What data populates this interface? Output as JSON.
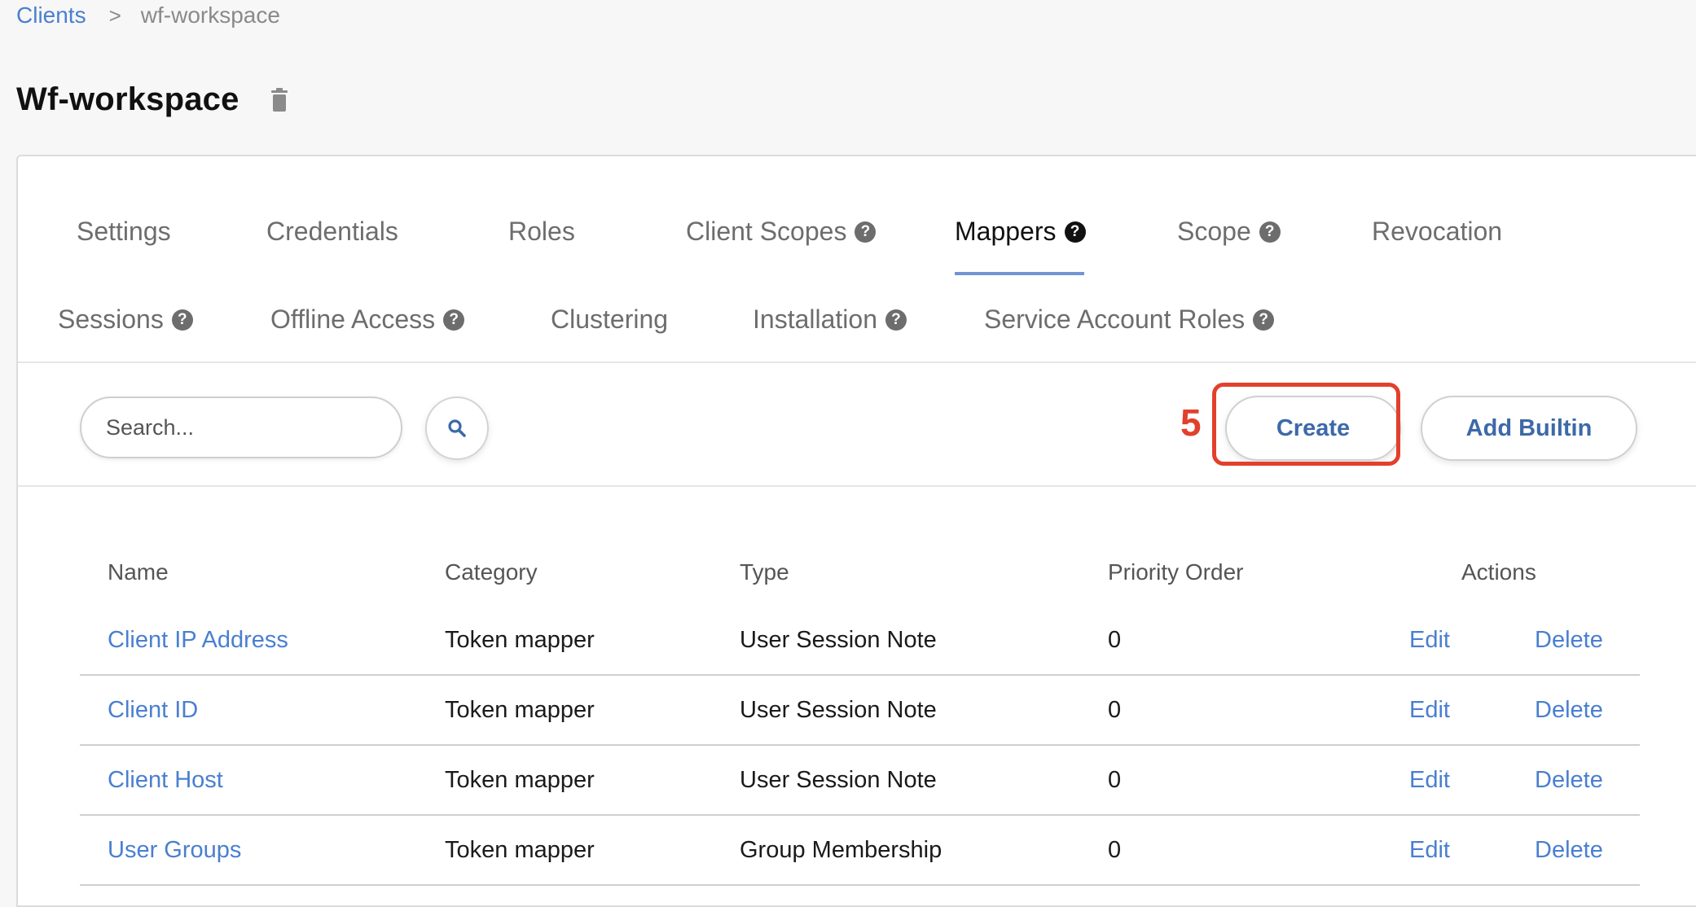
{
  "breadcrumb": {
    "parent": "Clients",
    "separator": ">",
    "current": "wf-workspace"
  },
  "page": {
    "title": "Wf-workspace",
    "delete_icon": "trash-icon"
  },
  "tabs": {
    "settings": "Settings",
    "credentials": "Credentials",
    "roles": "Roles",
    "client_scopes": "Client Scopes",
    "mappers": "Mappers",
    "scope": "Scope",
    "revocation": "Revocation",
    "sessions": "Sessions",
    "offline_access": "Offline Access",
    "clustering": "Clustering",
    "installation": "Installation",
    "service_account_roles": "Service Account Roles",
    "help_icon_glyph": "?",
    "active": "Mappers"
  },
  "toolbar": {
    "search_placeholder": "Search...",
    "search_icon": "search-icon",
    "create_label": "Create",
    "add_builtin_label": "Add Builtin",
    "annotation_number": "5"
  },
  "table": {
    "headers": {
      "name": "Name",
      "category": "Category",
      "type": "Type",
      "priority": "Priority Order",
      "actions": "Actions"
    },
    "rows": [
      {
        "name": "Client IP Address",
        "category": "Token mapper",
        "type": "User Session Note",
        "priority": "0",
        "edit": "Edit",
        "delete": "Delete"
      },
      {
        "name": "Client ID",
        "category": "Token mapper",
        "type": "User Session Note",
        "priority": "0",
        "edit": "Edit",
        "delete": "Delete"
      },
      {
        "name": "Client Host",
        "category": "Token mapper",
        "type": "User Session Note",
        "priority": "0",
        "edit": "Edit",
        "delete": "Delete"
      },
      {
        "name": "User Groups",
        "category": "Token mapper",
        "type": "Group Membership",
        "priority": "0",
        "edit": "Edit",
        "delete": "Delete"
      }
    ]
  },
  "colors": {
    "link": "#4a7fd0",
    "button_text": "#3d69a8",
    "active_tab_underline": "#6f95d5",
    "annotation": "#e2402c"
  }
}
